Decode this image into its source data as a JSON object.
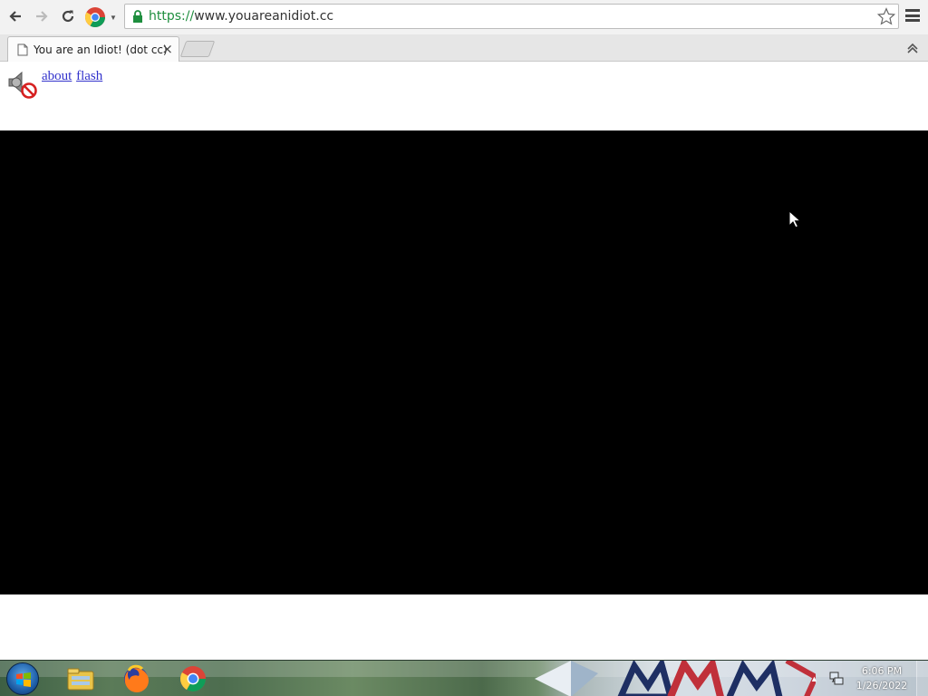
{
  "browser": {
    "url_scheme": "https://",
    "url_host": "www.youareanidiot.cc",
    "tab_title": "You are an Idiot! (dot cc)",
    "tab_close": "×"
  },
  "page": {
    "links": [
      {
        "label": "about"
      },
      {
        "label": "flash"
      }
    ]
  },
  "taskbar": {
    "clock_time": "6:06 PM",
    "clock_date": "1/26/2022",
    "tray_arrow": "▲",
    "pinned": [
      "file-explorer-icon",
      "firefox-icon",
      "chrome-icon"
    ]
  }
}
